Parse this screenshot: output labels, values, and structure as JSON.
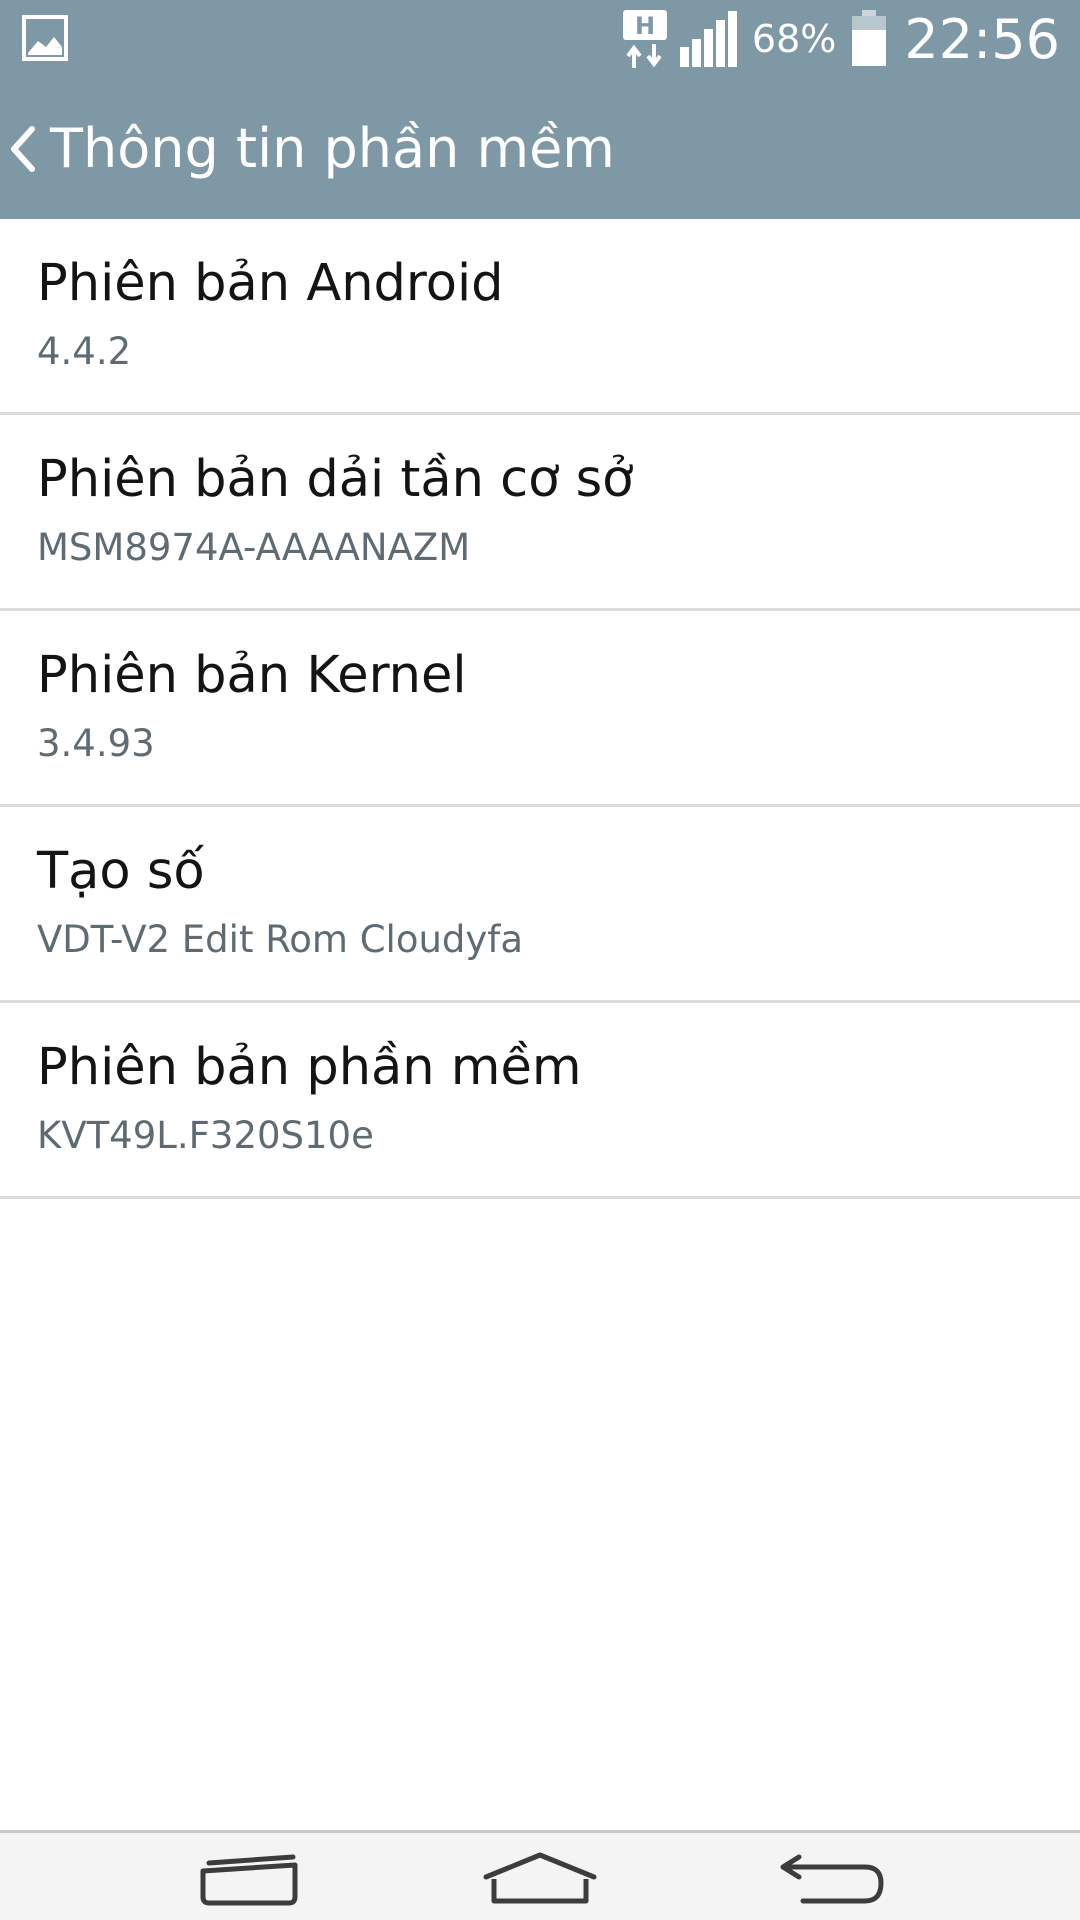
{
  "status_bar": {
    "left_icon": "image-icon",
    "network_icon": "hspa-data-icon",
    "network_label": "H",
    "signal_icon": "signal-icon",
    "battery_percent": "68%",
    "battery_icon": "battery-icon",
    "time": "22:56"
  },
  "header": {
    "back_icon": "chevron-left-icon",
    "title": "Thông tin phần mềm"
  },
  "items": [
    {
      "title": "Phiên bản Android",
      "value": "4.4.2"
    },
    {
      "title": "Phiên bản dải tần cơ sở",
      "value": "MSM8974A-AAAANAZM"
    },
    {
      "title": "Phiên bản Kernel",
      "value": "3.4.93"
    },
    {
      "title": "Tạo số",
      "value": "VDT-V2 Edit Rom Cloudyfa"
    },
    {
      "title": "Phiên bản phần mềm",
      "value": "KVT49L.F320S10e"
    }
  ],
  "navbar": {
    "recent_icon": "recent-apps-icon",
    "home_icon": "home-icon",
    "back_icon": "back-arrow-icon"
  },
  "colors": {
    "header_bg": "#7f98a5",
    "title_text": "#141414",
    "value_text": "#5e6b73",
    "divider": "#dcdcdc"
  }
}
